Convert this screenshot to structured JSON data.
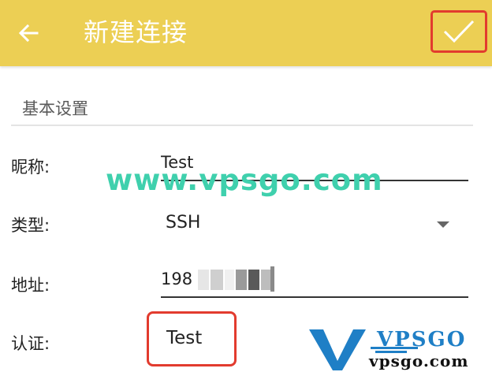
{
  "appbar": {
    "title": "新建连接",
    "back_icon": "arrow-left-icon",
    "confirm_icon": "check-icon",
    "background": "#eccf54",
    "highlight": "#e23b2e"
  },
  "form": {
    "section_title": "基本设置",
    "nickname": {
      "label": "昵称:",
      "value": "Test"
    },
    "type": {
      "label": "类型:",
      "value": "SSH"
    },
    "address": {
      "label": "地址:",
      "value": "198"
    },
    "auth": {
      "label": "认证:",
      "value": "Test"
    }
  },
  "watermark": {
    "text": "www.vpsgo.com",
    "color": "#3fd0ad"
  },
  "logo": {
    "brand": "VPSGO",
    "domain": "vpsgo.com",
    "color": "#1f7fc6"
  }
}
